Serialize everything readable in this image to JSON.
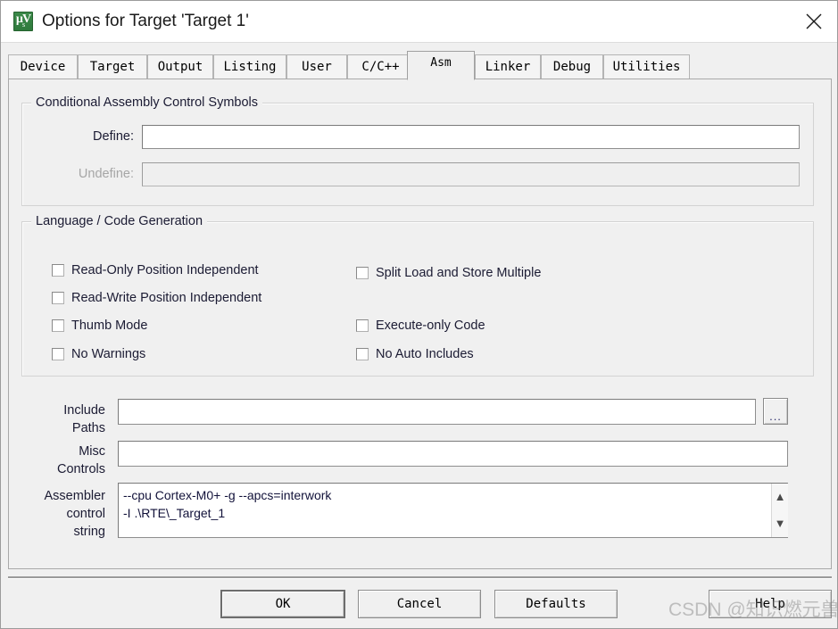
{
  "window": {
    "title": "Options for Target 'Target 1'",
    "icon": "keil-uvision-icon",
    "close_icon": "close-icon"
  },
  "tabs": [
    {
      "label": "Device",
      "selected": false
    },
    {
      "label": "Target",
      "selected": false
    },
    {
      "label": "Output",
      "selected": false
    },
    {
      "label": "Listing",
      "selected": false
    },
    {
      "label": "User",
      "selected": false
    },
    {
      "label": "C/C++",
      "selected": false
    },
    {
      "label": "Asm",
      "selected": true
    },
    {
      "label": "Linker",
      "selected": false
    },
    {
      "label": "Debug",
      "selected": false
    },
    {
      "label": "Utilities",
      "selected": false
    }
  ],
  "conditional_assembly": {
    "legend": "Conditional Assembly Control Symbols",
    "define": {
      "label": "Define:",
      "value": "",
      "enabled": true
    },
    "undefine": {
      "label": "Undefine:",
      "value": "",
      "enabled": false
    }
  },
  "language_code_generation": {
    "legend": "Language / Code Generation",
    "left_options": [
      {
        "label": "Read-Only Position Independent",
        "checked": false
      },
      {
        "label": "Read-Write Position Independent",
        "checked": false
      },
      {
        "label": "Thumb Mode",
        "checked": false
      },
      {
        "label": "No Warnings",
        "checked": false
      }
    ],
    "right_options": [
      {
        "label": "Split Load and Store Multiple",
        "checked": false
      },
      {
        "label": "Execute-only Code",
        "checked": false
      },
      {
        "label": "No Auto Includes",
        "checked": false
      }
    ]
  },
  "paths": {
    "include_paths": {
      "label_line1": "Include",
      "label_line2": "Paths",
      "value": "",
      "browse_label": "..."
    },
    "misc_controls": {
      "label_line1": "Misc",
      "label_line2": "Controls",
      "value": ""
    },
    "assembler_control_string": {
      "label_line1": "Assembler",
      "label_line2": "control",
      "label_line3": "string",
      "value": "--cpu Cortex-M0+ -g --apcs=interwork\n-I .\\RTE\\_Target_1",
      "scroll_up_icon": "chevron-up-icon",
      "scroll_down_icon": "chevron-down-icon"
    }
  },
  "footer": {
    "ok": "OK",
    "cancel": "Cancel",
    "defaults": "Defaults",
    "help": "Help"
  },
  "watermark": {
    "text": "CSDN @知识燃元兽"
  },
  "colors": {
    "dialog_bg": "#f0f0f0",
    "titlebar_bg": "#ffffff",
    "text": "#1b1b33",
    "disabled_text": "#a6a6a6",
    "icon_green": "#2f7a3d",
    "field_bg": "#ffffff",
    "border": "#8e8e8e"
  }
}
